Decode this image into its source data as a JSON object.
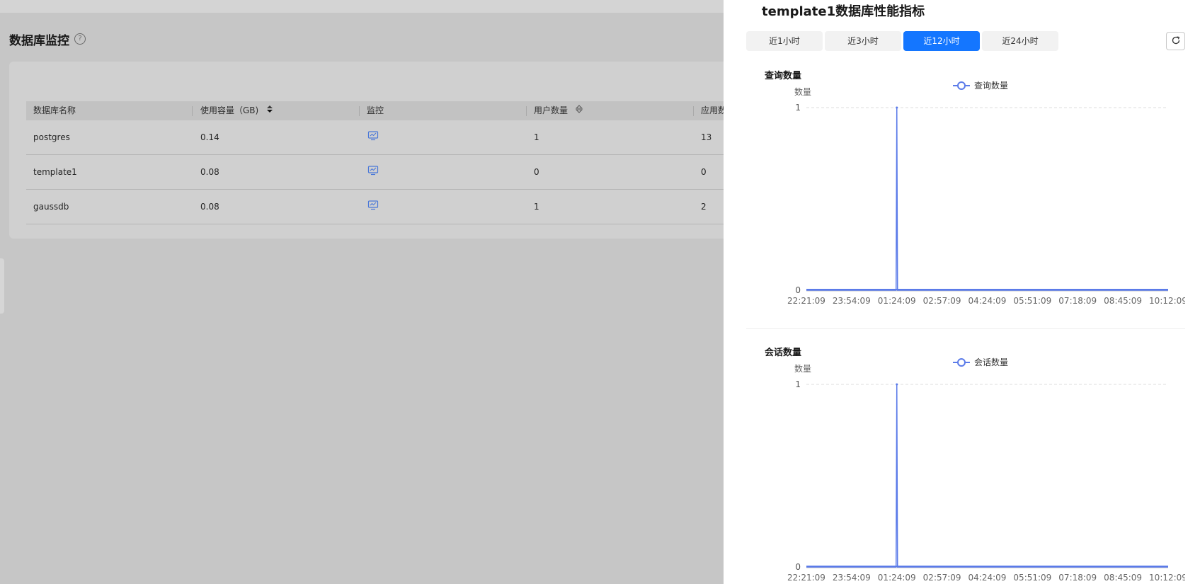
{
  "page": {
    "title": "数据库监控",
    "help_icon": "help-circle-icon"
  },
  "table": {
    "columns": [
      "数据库名称",
      "使用容量（GB)",
      "监控",
      "用户数量",
      "应用数"
    ],
    "rows": [
      {
        "name": "postgres",
        "size": "0.14",
        "users": "1",
        "apps": "13"
      },
      {
        "name": "template1",
        "size": "0.08",
        "users": "0",
        "apps": "0"
      },
      {
        "name": "gaussdb",
        "size": "0.08",
        "users": "1",
        "apps": "2"
      }
    ],
    "monitor_icon": "monitor-chart-icon",
    "sort_icon": "sort-icon"
  },
  "drawer": {
    "title": "template1数据库性能指标",
    "time_tabs": [
      "近1小时",
      "近3小时",
      "近12小时",
      "近24小时"
    ],
    "active_tab": "近12小时",
    "refresh_icon": "refresh-icon"
  },
  "colors": {
    "accent": "#1476ff",
    "series_line": "#5b7be9"
  },
  "chart_data": [
    {
      "type": "line",
      "title": "查询数量",
      "ylabel": "数量",
      "legend": "top-center",
      "x": [
        "22:21:09",
        "23:54:09",
        "01:24:09",
        "02:57:09",
        "04:24:09",
        "05:51:09",
        "07:18:09",
        "08:45:09",
        "10:12:09"
      ],
      "ylim": [
        0,
        1
      ],
      "yticks": [
        0,
        1
      ],
      "series": [
        {
          "name": "查询数量",
          "spike_at": "01:24:09",
          "spike_value": 1,
          "baseline": 0
        }
      ]
    },
    {
      "type": "line",
      "title": "会话数量",
      "ylabel": "数量",
      "legend": "top-center",
      "x": [
        "22:21:09",
        "23:54:09",
        "01:24:09",
        "02:57:09",
        "04:24:09",
        "05:51:09",
        "07:18:09",
        "08:45:09",
        "10:12:09"
      ],
      "ylim": [
        0,
        1
      ],
      "yticks": [
        0,
        1
      ],
      "series": [
        {
          "name": "会话数量",
          "spike_at": "01:24:09",
          "spike_value": 1,
          "baseline": 0
        }
      ]
    }
  ]
}
